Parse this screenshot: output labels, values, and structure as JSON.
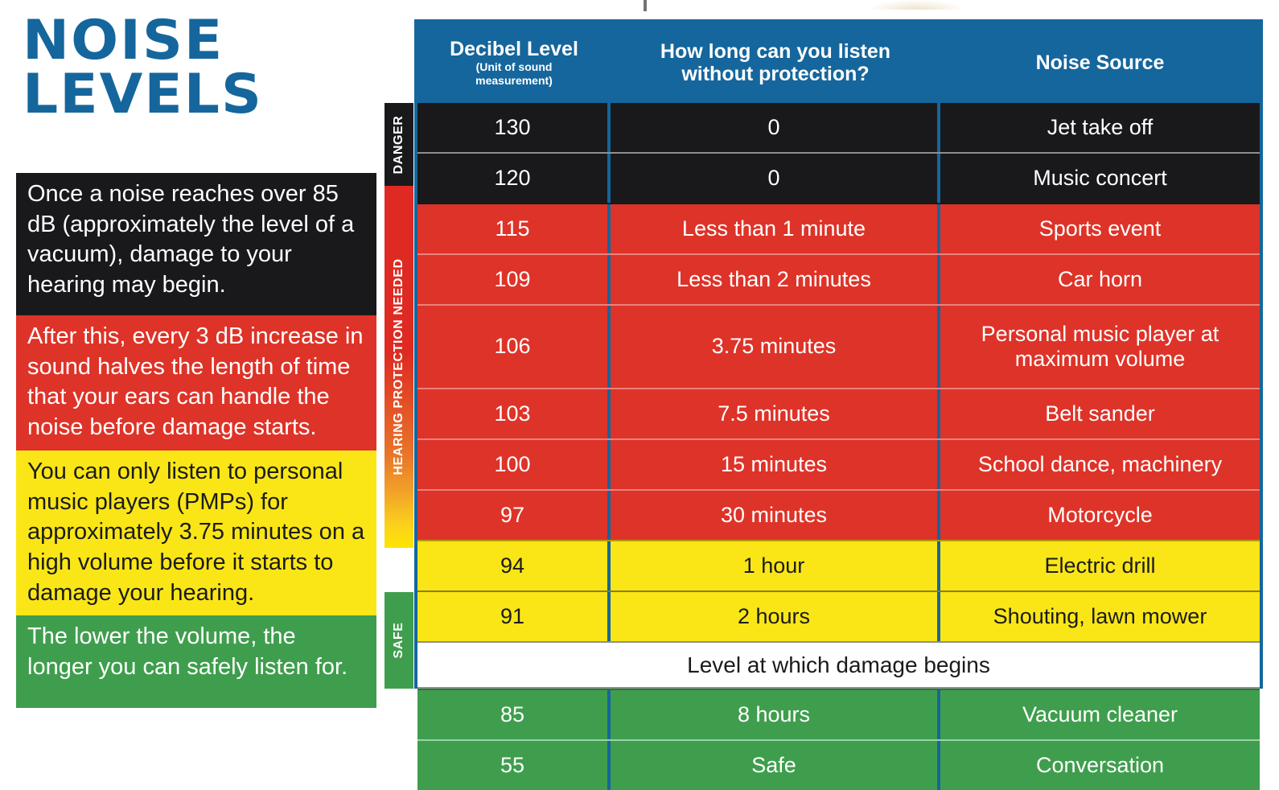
{
  "title": {
    "line1": "NOISE",
    "line2": "LEVELS"
  },
  "facts": [
    {
      "id": "fact-damage-threshold",
      "style": "black",
      "text": "Once a noise reaches over 85 dB (approximately the level of a vacuum), damage to your hearing may begin."
    },
    {
      "id": "fact-3db-rule",
      "style": "red",
      "text": "After this, every 3 dB increase in sound halves the length of time that your ears can handle the noise before damage starts."
    },
    {
      "id": "fact-pmp-limit",
      "style": "yellow",
      "text": "You can only listen to personal music players (PMPs) for approximately 3.75 minutes on a high volume before it starts to damage your hearing."
    },
    {
      "id": "fact-lower-volume",
      "style": "green",
      "text": "The lower the volume, the longer you can safely listen for."
    }
  ],
  "side_labels": {
    "danger": "DANGER",
    "protection": "HEARING PROTECTION NEEDED",
    "safe": "SAFE"
  },
  "table": {
    "headers": {
      "col1_title": "Decibel Level",
      "col1_sub_line1": "(Unit of sound",
      "col1_sub_line2": "measurement)",
      "col2_title_line1": "How long can you listen",
      "col2_title_line2": "without protection?",
      "col3_title": "Noise Source"
    },
    "rows": [
      {
        "band": "danger",
        "decibel": "130",
        "duration": "0",
        "source": "Jet take off"
      },
      {
        "band": "danger",
        "decibel": "120",
        "duration": "0",
        "source": "Music concert"
      },
      {
        "band": "protection",
        "decibel": "115",
        "duration": "Less than 1 minute",
        "source": "Sports event"
      },
      {
        "band": "protection",
        "decibel": "109",
        "duration": "Less than 2 minutes",
        "source": "Car horn"
      },
      {
        "band": "protection",
        "decibel": "106",
        "duration": "3.75 minutes",
        "source": "Personal music player at maximum volume"
      },
      {
        "band": "protection",
        "decibel": "103",
        "duration": "7.5 minutes",
        "source": "Belt sander"
      },
      {
        "band": "protection",
        "decibel": "100",
        "duration": "15 minutes",
        "source": "School dance, machinery"
      },
      {
        "band": "protection",
        "decibel": "97",
        "duration": "30 minutes",
        "source": "Motorcycle"
      },
      {
        "band": "caution",
        "decibel": "94",
        "duration": "1 hour",
        "source": "Electric drill"
      },
      {
        "band": "caution",
        "decibel": "91",
        "duration": "2 hours",
        "source": "Shouting, lawn mower"
      },
      {
        "band": "safe",
        "decibel": "85",
        "duration": "8 hours",
        "source": "Vacuum cleaner"
      },
      {
        "band": "safe",
        "decibel": "55",
        "duration": "Safe",
        "source": "Conversation"
      }
    ],
    "divider_label": "Level at which damage begins",
    "divider_after_index": 9
  },
  "colors": {
    "brand_blue": "#15669c",
    "danger_black": "#19191b",
    "warning_red": "#de3328",
    "caution_yellow": "#fae616",
    "safe_green": "#3f9e4d"
  }
}
